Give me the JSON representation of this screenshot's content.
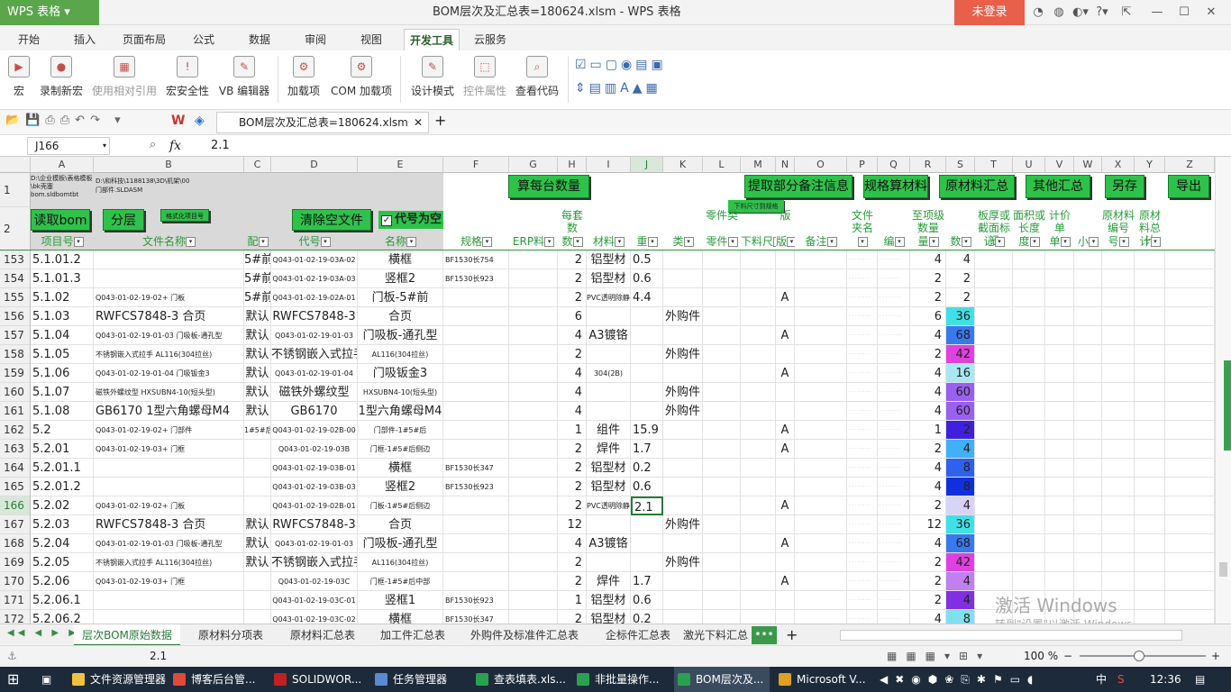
{
  "app": {
    "name": "WPS 表格",
    "title": "BOM层次及汇总表=180624.xlsm - WPS 表格",
    "login": "未登录"
  },
  "tabs": [
    "开始",
    "插入",
    "页面布局",
    "公式",
    "数据",
    "审阅",
    "视图",
    "开发工具",
    "云服务"
  ],
  "ribbon": [
    "宏",
    "录制新宏",
    "使用相对引用",
    "宏安全性",
    "VB 编辑器",
    "加载项",
    "COM 加载项",
    "设计模式",
    "控件属性",
    "查看代码"
  ],
  "doc_tab": "BOM层次及汇总表=180624.xlsm",
  "formula": {
    "name_box": "J166",
    "fx": "fx",
    "value": "2.1"
  },
  "columns": [
    "A",
    "B",
    "C",
    "D",
    "E",
    "F",
    "G",
    "H",
    "I",
    "J",
    "K",
    "L",
    "M",
    "N",
    "O",
    "P",
    "Q",
    "R",
    "S",
    "T",
    "U",
    "V",
    "W",
    "X",
    "Y",
    "Z"
  ],
  "row1": {
    "a_text": "D:\\企业模板\\表格模板\\bk壳塞bom.sldbomtbt",
    "b_text": "D:\\和科技\\1188138\\3D\\机架\\00门部件.SLDASM",
    "btn_count": "算每台数量",
    "btn_extract": "提取部分备注信息",
    "btn_spec": "规格算材料",
    "btn_raw": "原材料汇总",
    "btn_other": "其他汇总",
    "btn_saveas": "另存",
    "btn_export": "导出",
    "m_small": "下料尺寸到规格"
  },
  "row2": {
    "btn_read": "读取bom",
    "btn_level": "分层",
    "btn_format": "格式化项目号",
    "btn_clear": "清除空文件",
    "chk_label": "代号为空",
    "h": "每套数",
    "k": "零件类",
    "n": "版",
    "p": "文件夹名",
    "r": "至项级数量",
    "t": "板厚或截面标记",
    "u": "面积或长度",
    "v": "计价单",
    "x": "原材料编号",
    "y": "原材料总计"
  },
  "hdr_row": [
    "项目号",
    "文件名称",
    "配",
    "代号",
    "名称",
    "规格",
    "ERP料",
    "数",
    "材料",
    "重",
    "类",
    "零件",
    "下料尺",
    "版",
    "备注",
    "",
    "编",
    "量",
    "数",
    "记",
    "度",
    "单",
    "小",
    "号",
    "计"
  ],
  "rows": [
    {
      "n": "153",
      "a": "5.1.01.2",
      "b": "",
      "c": "5#前",
      "d": "Q043-01-02-19-03A-02",
      "e": "横框",
      "f": "BF1530长754",
      "h": "2",
      "i": "铝型材",
      "j": "0.5",
      "k": "",
      "nn": "",
      "r": "4",
      "s": "4",
      "sc": ""
    },
    {
      "n": "154",
      "a": "5.1.01.3",
      "b": "",
      "c": "5#前",
      "d": "Q043-01-02-19-03A-03",
      "e": "竖框2",
      "f": "BF1530长923",
      "h": "2",
      "i": "铝型材",
      "j": "0.6",
      "k": "",
      "nn": "",
      "r": "2",
      "s": "2",
      "sc": ""
    },
    {
      "n": "155",
      "a": "5.1.02",
      "b": "Q043-01-02-19-02+ 门板",
      "c": "5#前",
      "d": "Q043-01-02-19-02A-01",
      "e": "门板-5#前",
      "f": "",
      "h": "2",
      "i": "PVC透明除静电",
      "j": "4.4",
      "k": "",
      "nn": "A",
      "r": "2",
      "s": "2",
      "sc": ""
    },
    {
      "n": "156",
      "a": "5.1.03",
      "b": "RWFCS7848-3 合页",
      "c": "默认",
      "d": "RWFCS7848-3",
      "e": "合页",
      "f": "",
      "h": "6",
      "i": "",
      "j": "",
      "k": "外购件",
      "nn": "",
      "r": "6",
      "s": "36",
      "sc": "#40e0e8"
    },
    {
      "n": "157",
      "a": "5.1.04",
      "b": "Q043-01-02-19-01-03 门吸板-通孔型",
      "c": "默认",
      "d": "Q043-01-02-19-01-03",
      "e": "门吸板-通孔型",
      "f": "",
      "h": "4",
      "i": "A3镀铬",
      "j": "",
      "k": "",
      "nn": "A",
      "r": "4",
      "s": "68",
      "sc": "#3a78f0"
    },
    {
      "n": "158",
      "a": "5.1.05",
      "b": "不锈钢嵌入式拉手 AL116(304拉丝)",
      "c": "默认",
      "d": "不锈钢嵌入式拉手",
      "e": "AL116(304拉丝)",
      "f": "",
      "h": "2",
      "i": "",
      "j": "",
      "k": "外购件",
      "nn": "",
      "r": "2",
      "s": "42",
      "sc": "#e040e0"
    },
    {
      "n": "159",
      "a": "5.1.06",
      "b": "Q043-01-02-19-01-04 门吸钣金3",
      "c": "默认",
      "d": "Q043-01-02-19-01-04",
      "e": "门吸钣金3",
      "f": "",
      "h": "4",
      "i": "304(2B)",
      "j": "",
      "k": "",
      "nn": "A",
      "r": "4",
      "s": "16",
      "sc": "#a8e8f4"
    },
    {
      "n": "160",
      "a": "5.1.07",
      "b": "磁铁外螺纹型 HXSUBN4-10(短头型)",
      "c": "默认",
      "d": "磁铁外螺纹型",
      "e": "HXSUBN4-10(短头型)",
      "f": "",
      "h": "4",
      "i": "",
      "j": "",
      "k": "外购件",
      "nn": "",
      "r": "4",
      "s": "60",
      "sc": "#9a60f0"
    },
    {
      "n": "161",
      "a": "5.1.08",
      "b": "GB6170 1型六角螺母M4",
      "c": "默认",
      "d": "GB6170",
      "e": "1型六角螺母M4",
      "f": "",
      "h": "4",
      "i": "",
      "j": "",
      "k": "外购件",
      "nn": "",
      "r": "4",
      "s": "60",
      "sc": "#9a60f0"
    },
    {
      "n": "162",
      "a": "5.2",
      "b": "Q043-01-02-19-02+ 门部件",
      "c": "1#5#后",
      "d": "Q043-01-02-19-02B-00",
      "e": "门部件-1#5#后",
      "f": "",
      "h": "1",
      "i": "组件",
      "j": "15.9",
      "k": "",
      "nn": "A",
      "r": "1",
      "s": "2",
      "sc": "#4020e0"
    },
    {
      "n": "163",
      "a": "5.2.01",
      "b": "Q043-01-02-19-03+ 门框",
      "c": "",
      "d": "Q043-01-02-19-03B",
      "e": "门框-1#5#后侧边",
      "f": "",
      "h": "2",
      "i": "焊件",
      "j": "1.7",
      "k": "",
      "nn": "A",
      "r": "2",
      "s": "4",
      "sc": "#40b0f8"
    },
    {
      "n": "164",
      "a": "5.2.01.1",
      "b": "",
      "c": "",
      "d": "Q043-01-02-19-03B-01",
      "e": "横框",
      "f": "BF1530长347",
      "h": "2",
      "i": "铝型材",
      "j": "0.2",
      "k": "",
      "nn": "",
      "r": "4",
      "s": "8",
      "sc": "#3060f0"
    },
    {
      "n": "165",
      "a": "5.2.01.2",
      "b": "",
      "c": "",
      "d": "Q043-01-02-19-03B-03",
      "e": "竖框2",
      "f": "BF1530长923",
      "h": "2",
      "i": "铝型材",
      "j": "0.6",
      "k": "",
      "nn": "",
      "r": "4",
      "s": "8",
      "sc": "#1030e0"
    },
    {
      "n": "166",
      "a": "5.2.02",
      "b": "Q043-01-02-19-02+ 门板",
      "c": "",
      "d": "Q043-01-02-19-02B-01",
      "e": "门板-1#5#后侧边",
      "f": "",
      "h": "2",
      "i": "PVC透明除静电",
      "j": "2.1",
      "k": "",
      "nn": "A",
      "r": "2",
      "s": "4",
      "sc": "#d8d4f8"
    },
    {
      "n": "167",
      "a": "5.2.03",
      "b": "RWFCS7848-3 合页",
      "c": "默认",
      "d": "RWFCS7848-3",
      "e": "合页",
      "f": "",
      "h": "12",
      "i": "",
      "j": "",
      "k": "外购件",
      "nn": "",
      "r": "12",
      "s": "36",
      "sc": "#40e0e8"
    },
    {
      "n": "168",
      "a": "5.2.04",
      "b": "Q043-01-02-19-01-03 门吸板-通孔型",
      "c": "默认",
      "d": "Q043-01-02-19-01-03",
      "e": "门吸板-通孔型",
      "f": "",
      "h": "4",
      "i": "A3镀铬",
      "j": "",
      "k": "",
      "nn": "A",
      "r": "4",
      "s": "68",
      "sc": "#3a78f0"
    },
    {
      "n": "169",
      "a": "5.2.05",
      "b": "不锈钢嵌入式拉手 AL116(304拉丝)",
      "c": "默认",
      "d": "不锈钢嵌入式拉手",
      "e": "AL116(304拉丝)",
      "f": "",
      "h": "2",
      "i": "",
      "j": "",
      "k": "外购件",
      "nn": "",
      "r": "2",
      "s": "42",
      "sc": "#e040e0"
    },
    {
      "n": "170",
      "a": "5.2.06",
      "b": "Q043-01-02-19-03+ 门框",
      "c": "",
      "d": "Q043-01-02-19-03C",
      "e": "门框-1#5#后中部",
      "f": "",
      "h": "2",
      "i": "焊件",
      "j": "1.7",
      "k": "",
      "nn": "A",
      "r": "2",
      "s": "4",
      "sc": "#c080f0"
    },
    {
      "n": "171",
      "a": "5.2.06.1",
      "b": "",
      "c": "",
      "d": "Q043-01-02-19-03C-01",
      "e": "竖框1",
      "f": "BF1530长923",
      "h": "1",
      "i": "铝型材",
      "j": "0.6",
      "k": "",
      "nn": "",
      "r": "2",
      "s": "4",
      "sc": "#8030e0"
    },
    {
      "n": "172",
      "a": "5.2.06.2",
      "b": "",
      "c": "",
      "d": "Q043-01-02-19-03C-02",
      "e": "横框",
      "f": "BF1530长347",
      "h": "2",
      "i": "铝型材",
      "j": "0.2",
      "k": "",
      "nn": "",
      "r": "4",
      "s": "8",
      "sc": "#80e0f0"
    }
  ],
  "sheets": [
    "层次BOM原始数据",
    "原材料分项表",
    "原材料汇总表",
    "加工件汇总表",
    "外购件及标准件汇总表",
    "企标件汇总表",
    "激光下料汇总"
  ],
  "status": {
    "value": "2.1",
    "zoom": "100 %"
  },
  "watermark": {
    "line1": "激活 Windows",
    "line2": "转到\"设置\"以激活 Windows。"
  },
  "taskbar": [
    "文件资源管理器",
    "博客后台管...",
    "SOLIDWOR...",
    "任务管理器",
    "查表填表.xls...",
    "非批量操作...",
    "BOM层次及...",
    "Microsoft V..."
  ],
  "clock": "12:36",
  "tray_lang": "中"
}
